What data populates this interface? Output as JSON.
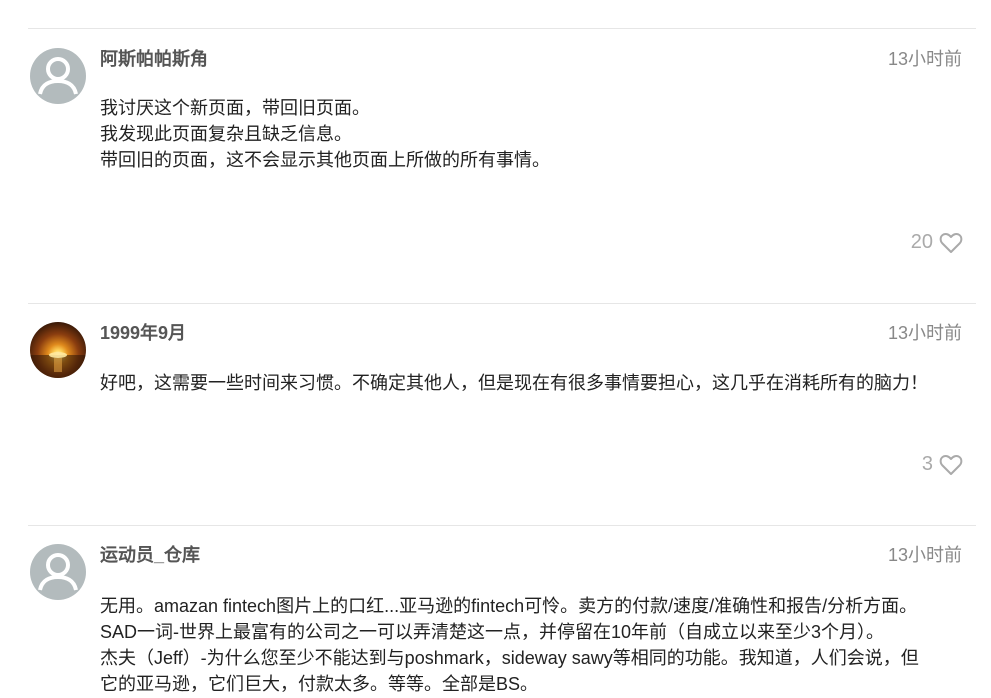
{
  "comments": [
    {
      "author": "阿斯帕帕斯角",
      "time": "13小时前",
      "lines": [
        "我讨厌这个新页面，带回旧页面。",
        "我发现此页面复杂且缺乏信息。",
        "带回旧的页面，这不会显示其他页面上所做的所有事情。"
      ],
      "likes": "20",
      "avatar": "default-user-icon"
    },
    {
      "author": "1999年9月",
      "time": "13小时前",
      "lines": [
        "好吧，这需要一些时间来习惯。不确定其他人，但是现在有很多事情要担心，这几乎在消耗所有的脑力！"
      ],
      "likes": "3",
      "avatar": "sunset-photo"
    },
    {
      "author": "运动员_仓库",
      "time": "13小时前",
      "lines": [
        "无用。amazan fintech图片上的口红...亚马逊的fintech可怜。卖方的付款/速度/准确性和报告/分析方面。",
        "SAD一词-世界上最富有的公司之一可以弄清楚这一点，并停留在10年前（自成立以来至少3个月）。",
        "杰夫（Jeff）-为什么您至少不能达到与poshmark，sideway sawy等相同的功能。我知道，人们会说，但",
        "它的亚马逊，它们巨大，付款太多。等等。全部是BS。"
      ],
      "avatar": "default-user-icon"
    }
  ],
  "colors": {
    "avatar_default": "#b3bbbd",
    "meta_text": "#888888",
    "like_icon": "#aaaaaa",
    "divider": "#e6e6e6"
  }
}
